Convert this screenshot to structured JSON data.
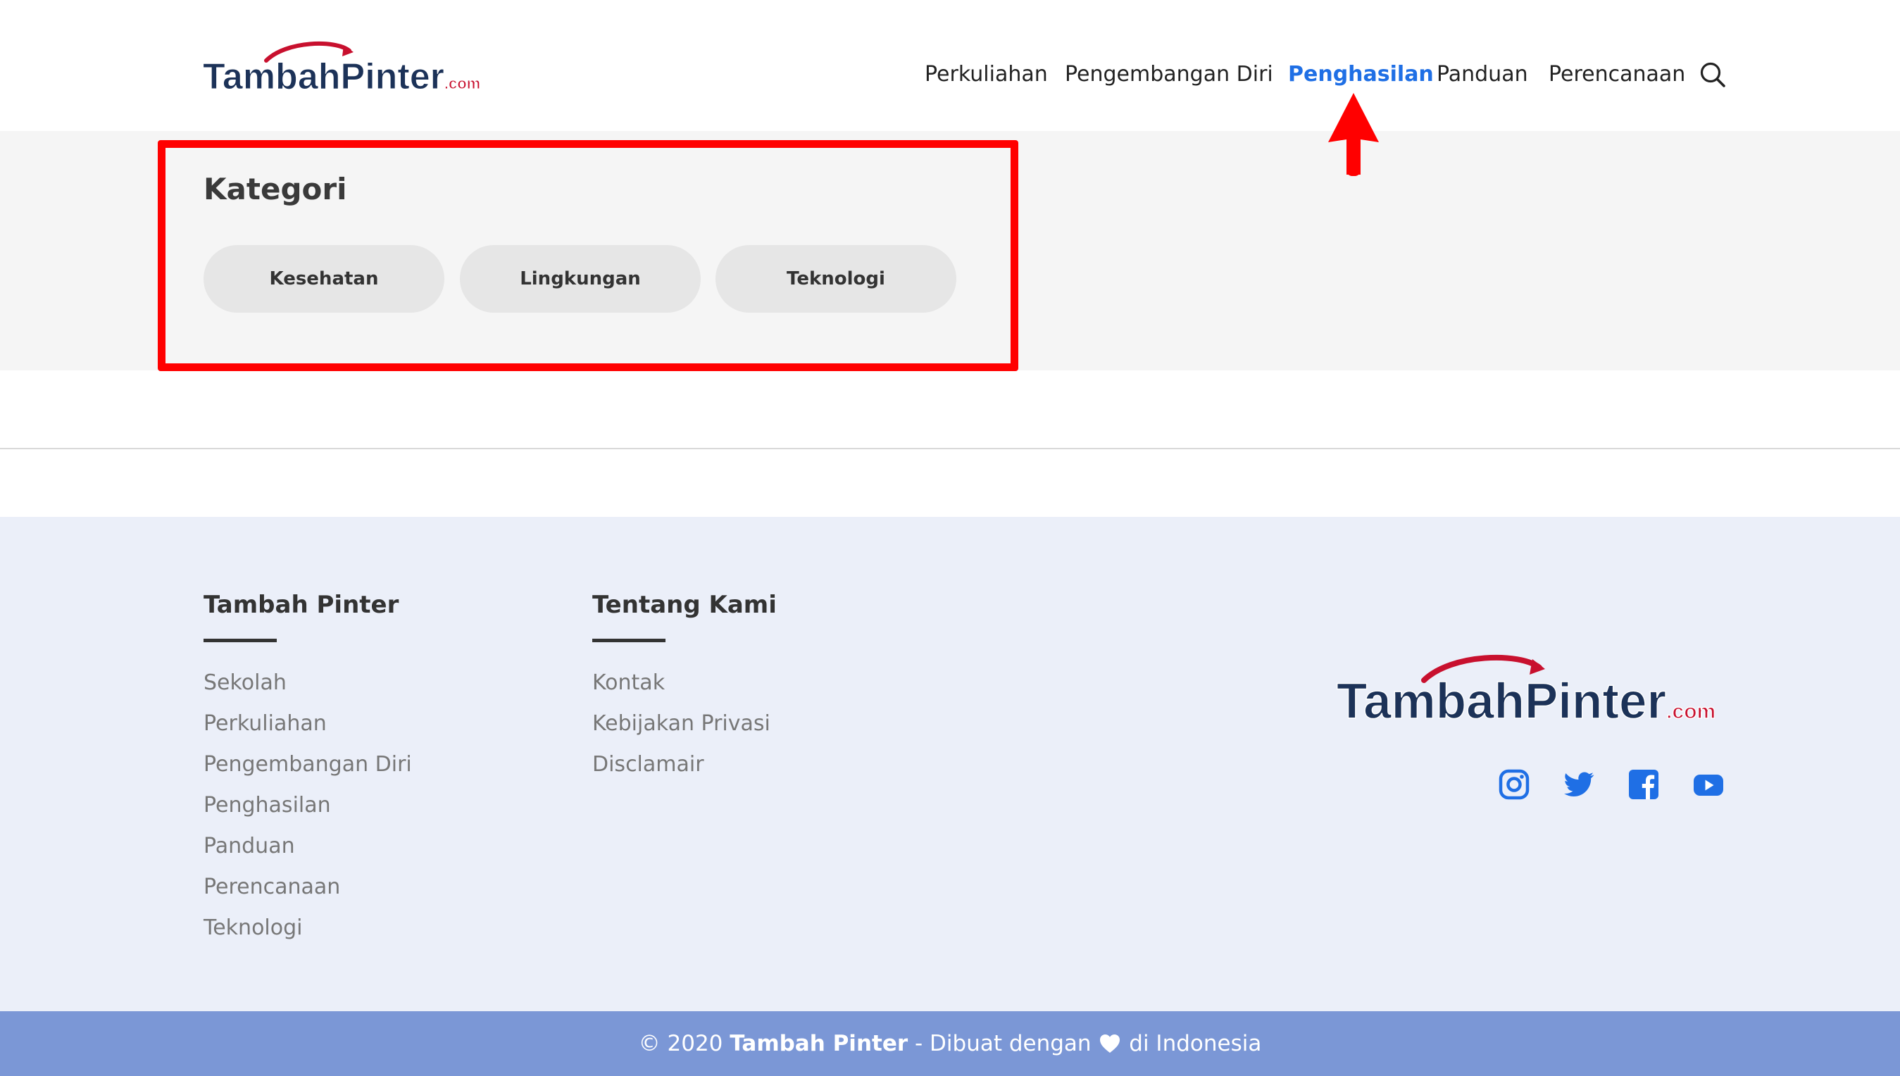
{
  "header": {
    "logo": {
      "word1": "Tambah",
      "word2": "Pinter",
      "suffix": ".com"
    },
    "nav": [
      {
        "label": "Perkuliahan"
      },
      {
        "label": "Pengembangan Diri"
      },
      {
        "label": "Penghasilan",
        "active": true
      },
      {
        "label": "Panduan"
      },
      {
        "label": "Perencanaan"
      }
    ],
    "search_icon": "search-icon"
  },
  "category": {
    "title": "Kategori",
    "pills": [
      {
        "label": "Kesehatan"
      },
      {
        "label": "Lingkungan"
      },
      {
        "label": "Teknologi"
      }
    ]
  },
  "footer": {
    "col1": {
      "heading": "Tambah Pinter",
      "links": [
        "Sekolah",
        "Perkuliahan",
        "Pengembangan Diri",
        "Penghasilan",
        "Panduan",
        "Perencanaan",
        "Teknologi"
      ]
    },
    "col2": {
      "heading": "Tentang Kami",
      "links": [
        "Kontak",
        "Kebijakan Privasi",
        "Disclamair"
      ]
    },
    "logo": {
      "word1": "Tambah",
      "word2": "Pinter",
      "suffix": ".com"
    },
    "social_icons": [
      "instagram-icon",
      "twitter-icon",
      "facebook-icon",
      "youtube-icon"
    ]
  },
  "bottom_bar": {
    "prefix": "© 2020 ",
    "brand": "Tambah Pinter",
    "middle": " - Dibuat dengan ",
    "suffix": " di Indonesia"
  },
  "colors": {
    "accent_blue": "#1f6fe5",
    "social_blue": "#1f6fe5",
    "logo_navy": "#1c3258",
    "logo_red": "#c8102e",
    "bottom_bar": "#7b97d6",
    "footer_bg": "#ebeff9",
    "highlight_red": "#ff0000"
  }
}
